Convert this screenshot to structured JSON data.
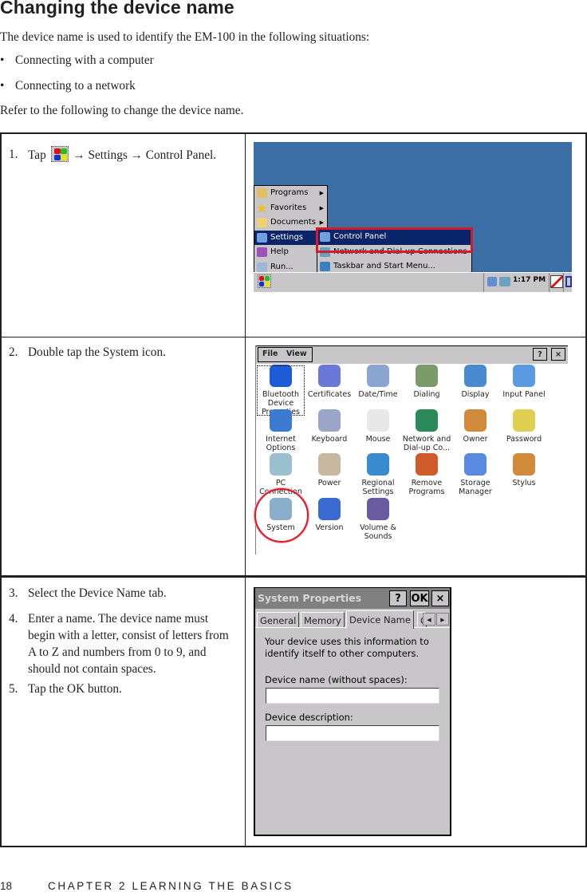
{
  "heading": "Changing the device name",
  "intro": "The device name is used to identify the EM-100 in the following situations:",
  "bullets": [
    {
      "symbol": "•",
      "text": "Connecting with a computer"
    },
    {
      "symbol": "•",
      "text": "Connecting to a network"
    }
  ],
  "refer": "Refer to the following to change the device name.",
  "steps": {
    "s1": {
      "num": "1.",
      "pre": "Tap",
      "icon": "windows-start-icon",
      "post": "→ Settings → Control Panel."
    },
    "s2": {
      "num": "2.",
      "text": "Double tap the System icon."
    },
    "s3": {
      "num": "3.",
      "text": "Select the Device Name tab."
    },
    "s4": {
      "num": "4.",
      "text": "Enter a name. The device name must begin with a letter, consist of letters from A to Z and numbers from 0 to 9, and should not contain spaces."
    },
    "s5": {
      "num": "5.",
      "text": "Tap the OK button."
    }
  },
  "screen1": {
    "start_menu": [
      {
        "label": "Programs",
        "icon": "programs-icon",
        "submenu": true
      },
      {
        "label": "Favorites",
        "icon": "favorites-star-icon",
        "submenu": true
      },
      {
        "label": "Documents",
        "icon": "documents-icon",
        "submenu": true
      },
      {
        "label": "Settings",
        "icon": "settings-icon",
        "submenu": false,
        "selected": true
      },
      {
        "label": "Help",
        "icon": "help-icon",
        "submenu": false
      },
      {
        "label": "Run...",
        "icon": "run-icon",
        "submenu": false
      }
    ],
    "settings_menu": [
      {
        "label": "Control Panel",
        "icon": "control-panel-icon",
        "selected": true
      },
      {
        "label": "Network and Dial-up Connections",
        "icon": "network-icon"
      },
      {
        "label": "Taskbar and Start Menu...",
        "icon": "taskbar-icon"
      }
    ],
    "clock": "1:17 PM",
    "desktop_color": "#3a6ea5",
    "highlight_color": "#d7192a"
  },
  "screen2": {
    "menu": [
      "File",
      "View"
    ],
    "help_btn": "?",
    "close_btn": "×",
    "items": [
      {
        "label": "Bluetooth Device Properties",
        "icon": "bluetooth-icon",
        "color": "#1e5bd6"
      },
      {
        "label": "Certificates",
        "icon": "certificates-gear-icon",
        "color": "#6a78d8"
      },
      {
        "label": "Date/Time",
        "icon": "date-time-icon",
        "color": "#8aa6d0"
      },
      {
        "label": "Dialing",
        "icon": "dialing-phone-icon",
        "color": "#7a9a6a"
      },
      {
        "label": "Display",
        "icon": "display-monitor-icon",
        "color": "#4a8ad0"
      },
      {
        "label": "Input Panel",
        "icon": "input-panel-icon",
        "color": "#5a9ae0"
      },
      {
        "label": "Internet Options",
        "icon": "internet-options-icon",
        "color": "#3a7ad0"
      },
      {
        "label": "Keyboard",
        "icon": "keyboard-icon",
        "color": "#9aa6c8"
      },
      {
        "label": "Mouse",
        "icon": "mouse-icon",
        "color": "#e8e8e8"
      },
      {
        "label": "Network and Dial-up Co...",
        "icon": "network-globe-icon",
        "color": "#2a8a5a"
      },
      {
        "label": "Owner",
        "icon": "owner-users-icon",
        "color": "#d08a3a"
      },
      {
        "label": "Password",
        "icon": "password-lock-icon",
        "color": "#e0d050"
      },
      {
        "label": "PC Connection",
        "icon": "pc-connection-icon",
        "color": "#9ac0d0"
      },
      {
        "label": "Power",
        "icon": "power-icon",
        "color": "#c8b8a0"
      },
      {
        "label": "Regional Settings",
        "icon": "regional-settings-icon",
        "color": "#3a8ad0"
      },
      {
        "label": "Remove Programs",
        "icon": "remove-programs-icon",
        "color": "#d05a2a"
      },
      {
        "label": "Storage Manager",
        "icon": "storage-manager-icon",
        "color": "#5a8ae0"
      },
      {
        "label": "Stylus",
        "icon": "stylus-icon",
        "color": "#d08a3a"
      },
      {
        "label": "System",
        "icon": "system-icon",
        "color": "#8ab0c8"
      },
      {
        "label": "Version",
        "icon": "version-icon",
        "color": "#3a6ad0"
      },
      {
        "label": "Volume & Sounds",
        "icon": "volume-sounds-icon",
        "color": "#6a5aa0"
      }
    ]
  },
  "screen3": {
    "title": "System Properties",
    "help_btn": "?",
    "ok_btn": "OK",
    "close_btn": "×",
    "tabs": [
      "General",
      "Memory",
      "Device Name",
      "C"
    ],
    "active_tab": "Device Name",
    "info": "Your device uses this information to identify itself to other computers.",
    "name_label": "Device name (without spaces):",
    "name_value": "",
    "desc_label": "Device description:",
    "desc_value": ""
  },
  "footer": {
    "page": "18",
    "chapter": "CHAPTER 2 LEARNING THE BASICS"
  }
}
